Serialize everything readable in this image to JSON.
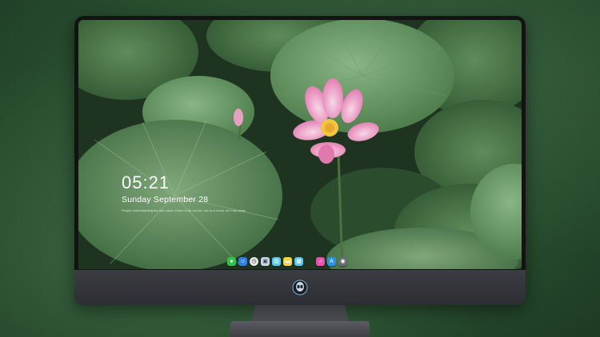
{
  "lock_screen": {
    "time": "05:21",
    "date": "Sunday September  28",
    "quote": "People understanding the true value of time to be our life, but as a result, let it slip away"
  },
  "dock": {
    "apps": [
      {
        "icon": "messages-icon",
        "color": "#36c24a",
        "glyph": "●"
      },
      {
        "icon": "finder-icon",
        "color": "#2f7fe0",
        "glyph": "☺"
      },
      {
        "icon": "clock-icon",
        "color": "#e8e8e8",
        "glyph": "◷"
      },
      {
        "icon": "preview-icon",
        "color": "#c9d6e6",
        "glyph": "▣"
      },
      {
        "icon": "claquette-icon",
        "color": "#5cc9e6",
        "glyph": "▤"
      },
      {
        "icon": "notes-icon",
        "color": "#f4d64a",
        "glyph": "▬"
      },
      {
        "icon": "photos-icon",
        "color": "#5ec4ea",
        "glyph": "▦"
      },
      {
        "icon": "itunes-icon",
        "color": "#ec4fa8",
        "glyph": "♫"
      },
      {
        "icon": "app-store-icon",
        "color": "#2e8fe8",
        "glyph": "A"
      },
      {
        "icon": "camera-icon",
        "color": "#6a6d73",
        "glyph": "◉"
      }
    ]
  },
  "colors": {
    "lotus_pink": "#f0a0c8",
    "leaf_green": "#5c8b5a",
    "bezel": "#131313",
    "chin": "#34363b"
  }
}
